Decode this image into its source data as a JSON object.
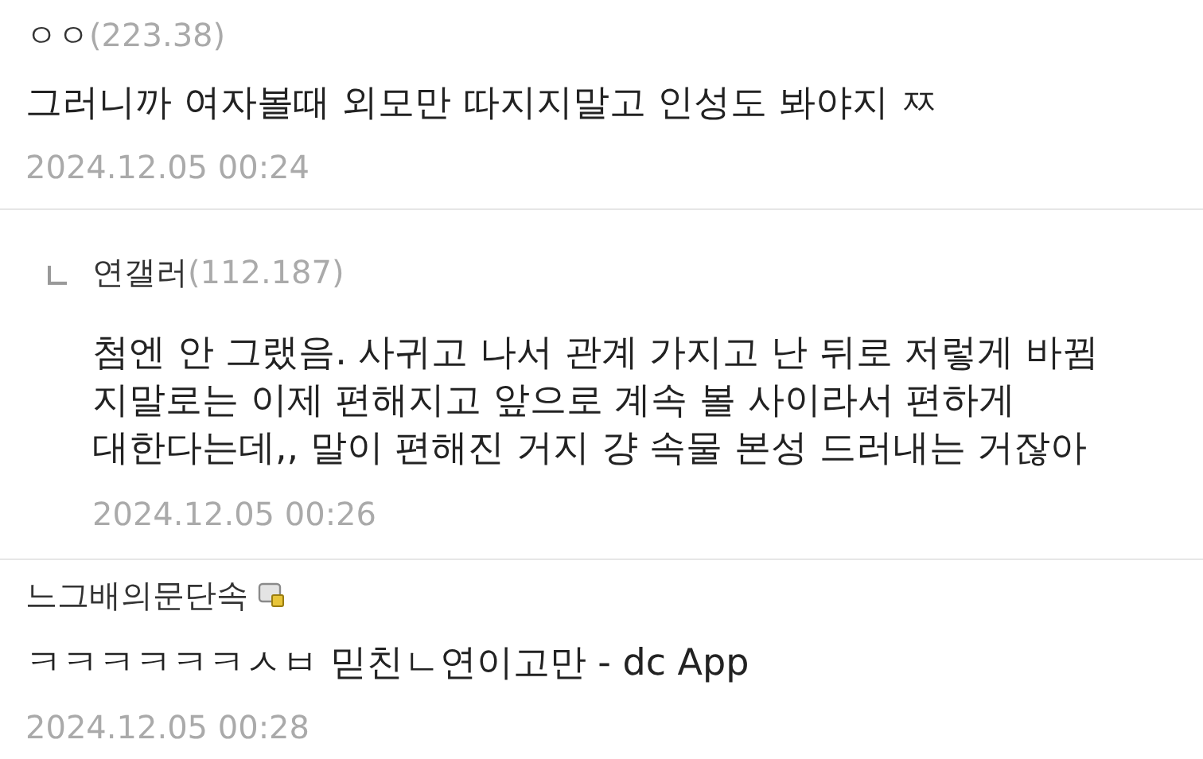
{
  "comments": [
    {
      "kind": "comment",
      "nickname": "ㅇㅇ",
      "ip": "(223.38)",
      "badge": false,
      "body": [
        "그러니까 여자볼때 외모만 따지지말고 인성도 봐야지 ㅉ"
      ],
      "date": "2024.12.05 00:24"
    },
    {
      "kind": "reply",
      "nickname": "연갤러",
      "ip": "(112.187)",
      "badge": false,
      "body": [
        "첨엔 안 그랬음. 사귀고 나서 관계 가지고 난 뒤로 저렇게 바뀜",
        "지말로는 이제 편해지고 앞으로 계속 볼 사이라서 편하게",
        "대한다는데,, 말이 편해진 거지 걍 속물 본성 드러내는 거잖아"
      ],
      "date": "2024.12.05 00:26"
    },
    {
      "kind": "comment",
      "nickname": "느그배의문단속",
      "badge": true,
      "body": [
        "ㅋㅋㅋㅋㅋㅋㅅㅂ 믿친ㄴ연이고만 - dc App"
      ],
      "date": "2024.12.05 00:28"
    }
  ]
}
